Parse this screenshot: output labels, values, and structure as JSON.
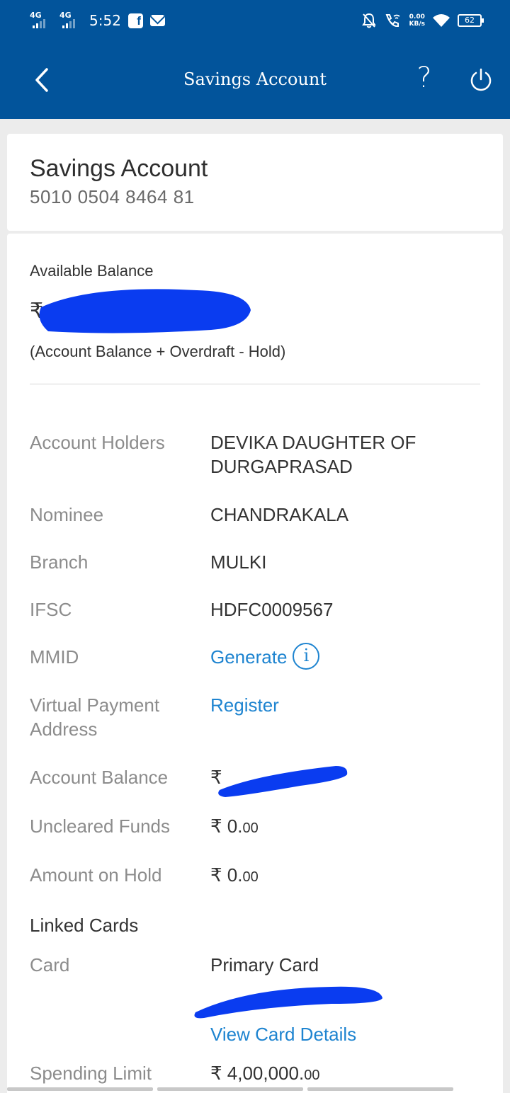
{
  "status_bar": {
    "net1": "4G",
    "net2": "4G",
    "time": "5:52",
    "speed_value": "0.00",
    "speed_unit": "KB/s",
    "battery": "62"
  },
  "app_bar": {
    "title": "Savings Account",
    "help": "?"
  },
  "account_header": {
    "type": "Savings Account",
    "number": "5010 0504 8464 81"
  },
  "balance": {
    "label": "Available Balance",
    "currency": "₹",
    "note": "(Account Balance + Overdraft - Hold)"
  },
  "details": {
    "account_holders_label": "Account Holders",
    "account_holders_value": "DEVIKA DAUGHTER OF DURGAPRASAD",
    "nominee_label": "Nominee",
    "nominee_value": "CHANDRAKALA",
    "branch_label": "Branch",
    "branch_value": "MULKI",
    "ifsc_label": "IFSC",
    "ifsc_value": "HDFC0009567",
    "mmid_label": "MMID",
    "mmid_action": "Generate",
    "info_glyph": "i",
    "vpa_label": "Virtual Payment Address",
    "vpa_action": "Register",
    "account_balance_label": "Account Balance",
    "account_balance_prefix": "₹",
    "uncleared_label": "Uncleared Funds",
    "uncleared_main": "₹ 0.",
    "uncleared_dec": "00",
    "hold_label": "Amount on Hold",
    "hold_main": "₹ 0.",
    "hold_dec": "00"
  },
  "linked_cards": {
    "title": "Linked Cards",
    "card_label": "Card",
    "card_value": "Primary Card",
    "view_details": "View Card Details",
    "spending_label": "Spending Limit",
    "spending_main": "₹ 4,00,000.",
    "spending_dec": "00"
  },
  "colors": {
    "brand": "#02549b",
    "link": "#1e84d0",
    "redaction": "#0a3cf0"
  },
  "icons": [
    "back-arrow-icon",
    "help-icon",
    "power-icon",
    "info-icon",
    "facebook-icon",
    "mail-icon",
    "wifi-icon",
    "battery-icon"
  ]
}
